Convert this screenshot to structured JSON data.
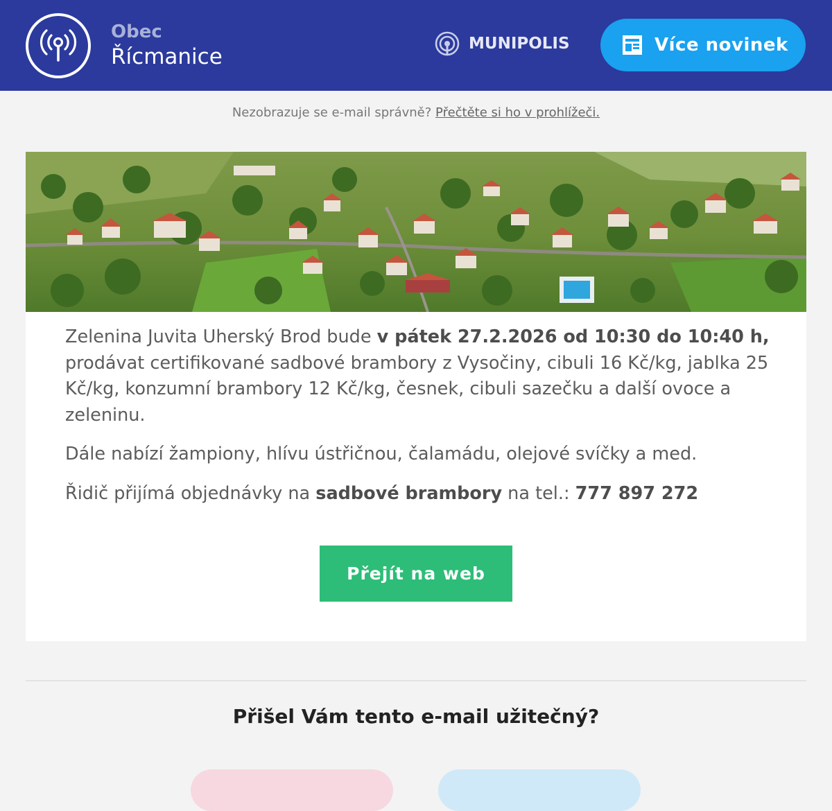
{
  "header": {
    "town_kind": "Obec",
    "town_name": "Řícmanice",
    "brand": "MUNIPOLIS",
    "more_news_label": "Více novinek",
    "bg_color": "#2b3a9c",
    "button_color": "#1aa1f0"
  },
  "notice": {
    "text": "Nezobrazuje se e-mail správně?",
    "link": "Přečtěte si ho v prohlížeči."
  },
  "article": {
    "p1_a": "Zelenina Juvita Uherský Brod bude ",
    "p1_bold": "v pátek 27.2.2026 od 10:30 do 10:40 h,",
    "p1_b": " prodávat certifikované sadbové brambory z Vysočiny, cibuli 16 Kč/kg, jablka  25 Kč/kg, konzumní brambory 12 Kč/kg, česnek, cibuli sazečku a další ovoce a zeleninu.",
    "p2": "Dále nabízí žampiony, hlívu ústřičnou, čalamádu, olejové svíčky a med.",
    "p3_a": "Řidič přijímá objednávky na ",
    "p3_bold1": "sadbové brambory",
    "p3_b": " na tel.: ",
    "p3_bold2": "777 897 272",
    "cta_label": "Přejít na web",
    "cta_color": "#2dbd78"
  },
  "feedback": {
    "question": "Přišel Vám tento e-mail užitečný?"
  }
}
